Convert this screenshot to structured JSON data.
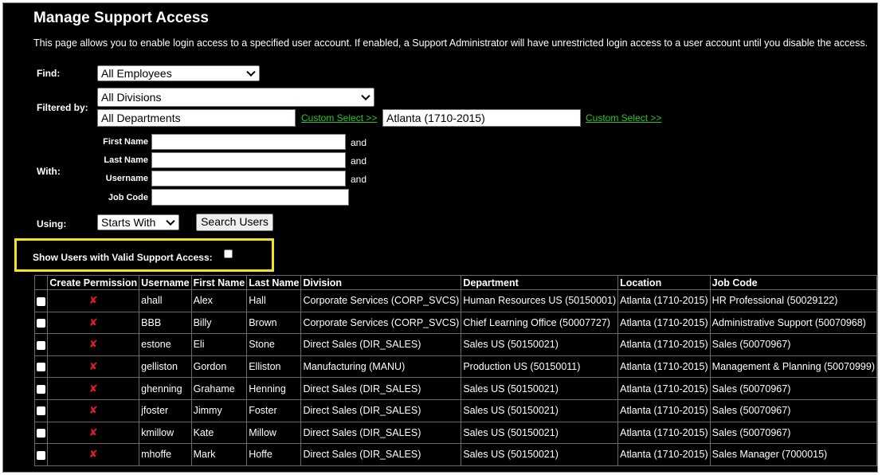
{
  "page": {
    "title": "Manage Support Access",
    "description": "This page allows you to enable login access to a specified user account. If enabled, a Support Administrator will have unrestricted login access to a user account until you disable the access."
  },
  "find": {
    "label": "Find:",
    "value": "All Employees"
  },
  "filtered": {
    "label": "Filtered by:",
    "division": "All Divisions",
    "department": "All Departments",
    "custom_select": "Custom Select >>",
    "location": "Atlanta (1710-2015)",
    "custom_select2": "Custom Select >>"
  },
  "with": {
    "label": "With:",
    "first_name": "First Name",
    "last_name": "Last Name",
    "username": "Username",
    "job_code": "Job Code",
    "and": "and"
  },
  "using": {
    "label": "Using:",
    "value": "Starts With",
    "search_button": "Search Users"
  },
  "show_valid": {
    "label": "Show Users with Valid Support Access:"
  },
  "table": {
    "headers": [
      "",
      "Create Permission",
      "Username",
      "First Name",
      "Last Name",
      "Division",
      "Department",
      "Location",
      "Job Code"
    ],
    "rows": [
      [
        "ahall",
        "Alex",
        "Hall",
        "Corporate Services (CORP_SVCS)",
        "Human Resources US (50150001)",
        "Atlanta (1710-2015)",
        "HR Professional (50029122)"
      ],
      [
        "BBB",
        "Billy",
        "Brown",
        "Corporate Services (CORP_SVCS)",
        "Chief Learning Office (50007727)",
        "Atlanta (1710-2015)",
        "Administrative Support (50070968)"
      ],
      [
        "estone",
        "Eli",
        "Stone",
        "Direct Sales (DIR_SALES)",
        "Sales US (50150021)",
        "Atlanta (1710-2015)",
        "Sales (50070967)"
      ],
      [
        "gelliston",
        "Gordon",
        "Elliston",
        "Manufacturing (MANU)",
        "Production US (50150011)",
        "Atlanta (1710-2015)",
        "Management & Planning (50070999)"
      ],
      [
        "ghenning",
        "Grahame",
        "Henning",
        "Direct Sales (DIR_SALES)",
        "Sales US (50150021)",
        "Atlanta (1710-2015)",
        "Sales (50070967)"
      ],
      [
        "jfoster",
        "Jimmy",
        "Foster",
        "Direct Sales (DIR_SALES)",
        "Sales US (50150021)",
        "Atlanta (1710-2015)",
        "Sales (50070967)"
      ],
      [
        "kmillow",
        "Kate",
        "Millow",
        "Direct Sales (DIR_SALES)",
        "Sales US (50150021)",
        "Atlanta (1710-2015)",
        "Sales (50070967)"
      ],
      [
        "mhoffe",
        "Mark",
        "Hoffe",
        "Direct Sales (DIR_SALES)",
        "Sales US (50150021)",
        "Atlanta (1710-2015)",
        "Sales Manager (7000015)"
      ]
    ],
    "x_symbol": "✘"
  },
  "colors": {
    "background": "#000000",
    "link": "#2ec427",
    "highlight": "#f0e61a",
    "x_mark": "#e02020"
  }
}
